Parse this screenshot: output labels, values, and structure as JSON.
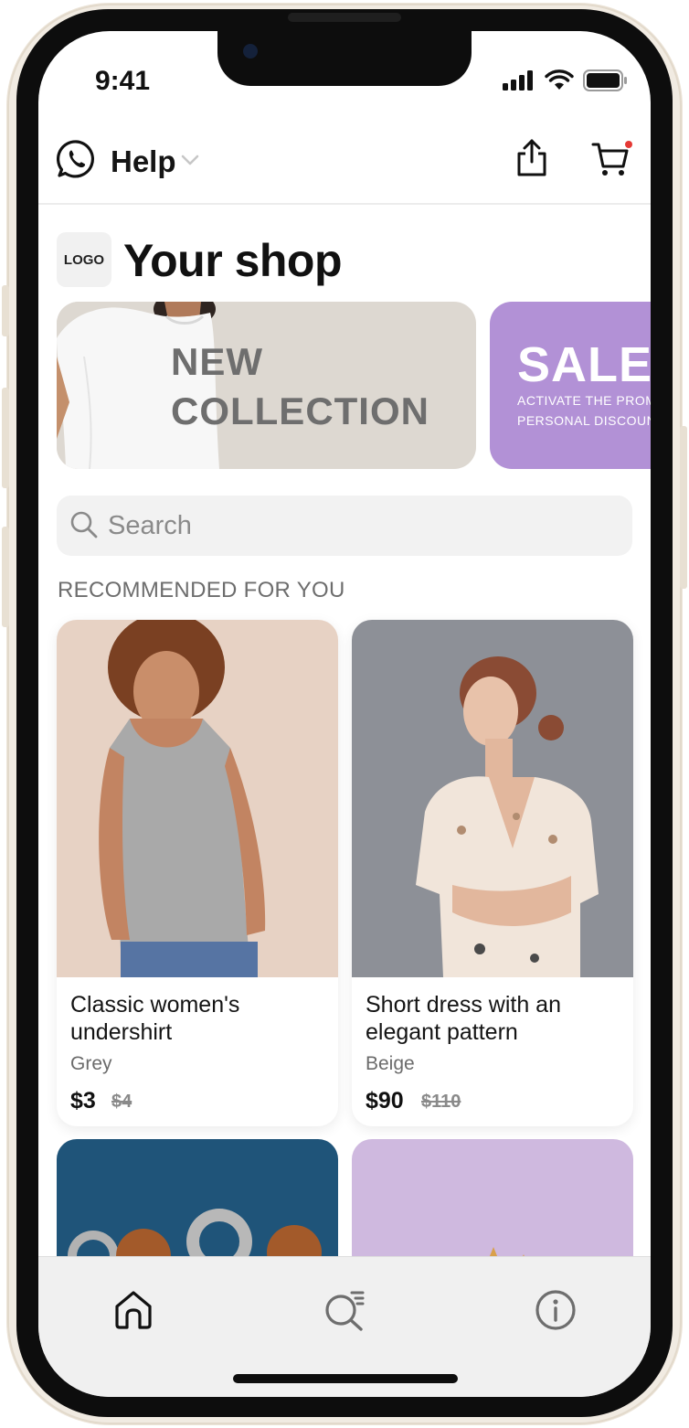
{
  "status_bar": {
    "time": "9:41"
  },
  "header": {
    "help_label": "Help"
  },
  "shop": {
    "logo_text": "LOGO",
    "title": "Your shop"
  },
  "banners": {
    "new_collection": {
      "line1": "NEW",
      "line2": "COLLECTION"
    },
    "sale": {
      "title": "SALE",
      "line1": "ACTIVATE THE PROMO",
      "line2": "PERSONAL DISCOUNT"
    }
  },
  "search": {
    "placeholder": "Search"
  },
  "section": {
    "recommended": "RECOMMENDED FOR YOU"
  },
  "products": [
    {
      "name": "Classic women's undershirt",
      "color": "Grey",
      "price": "$3",
      "old_price": "$4"
    },
    {
      "name": "Short dress with an elegant pattern",
      "color": "Beige",
      "price": "$90",
      "old_price": "$110"
    }
  ],
  "colors": {
    "sale_banner": "#b291d6",
    "cart_badge": "#e53935",
    "accent_text": "#111111"
  },
  "icons": {
    "help": "whatsapp-icon",
    "share": "share-icon",
    "cart": "cart-icon",
    "search": "search-icon",
    "home": "home-icon",
    "catalog_search": "catalog-search-icon",
    "info": "info-icon"
  }
}
